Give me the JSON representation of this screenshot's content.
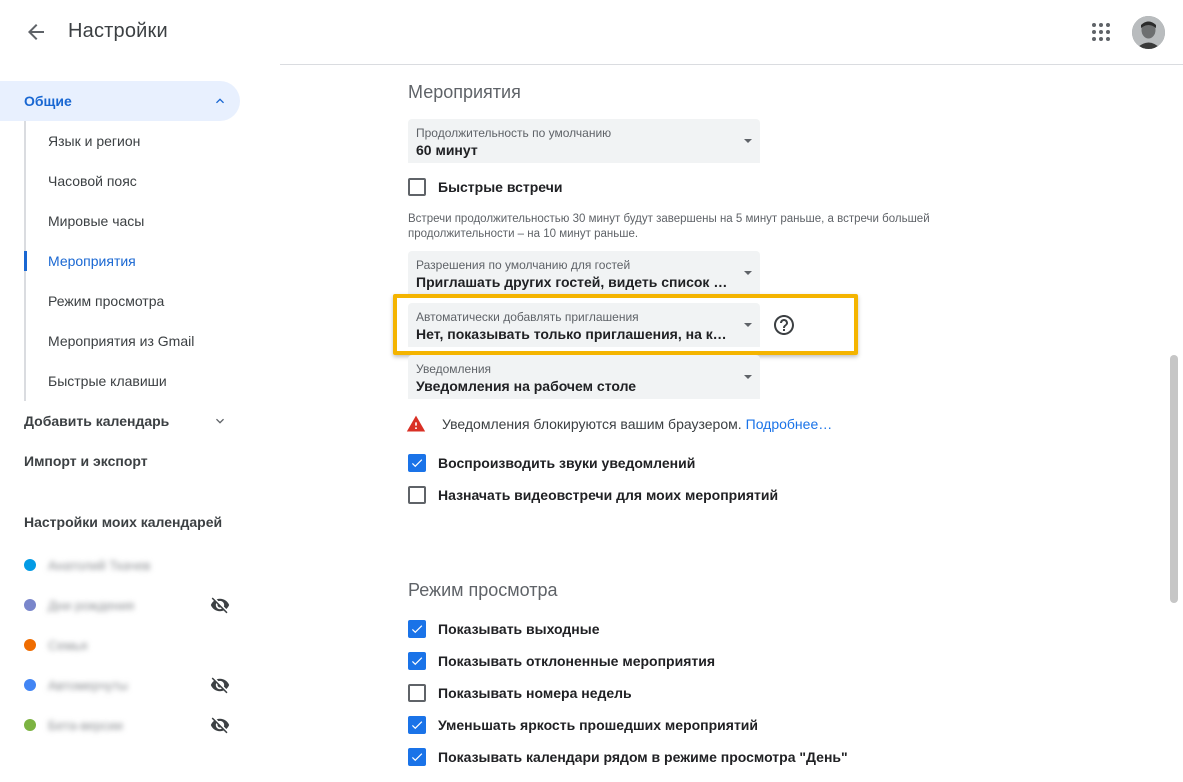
{
  "header": {
    "title": "Настройки",
    "back_icon": "arrow-back-icon",
    "apps_icon": "apps-grid-icon"
  },
  "sidebar": {
    "general": {
      "label": "Общие",
      "expanded": true
    },
    "sub_items": [
      {
        "label": "Язык и регион",
        "active": false
      },
      {
        "label": "Часовой пояс",
        "active": false
      },
      {
        "label": "Мировые часы",
        "active": false
      },
      {
        "label": "Мероприятия",
        "active": true
      },
      {
        "label": "Режим просмотра",
        "active": false
      },
      {
        "label": "Мероприятия из Gmail",
        "active": false
      },
      {
        "label": "Быстрые клавиши",
        "active": false
      }
    ],
    "add_calendar": "Добавить календарь",
    "import_export": "Импорт и экспорт",
    "my_calendars_heading": "Настройки моих календарей",
    "calendars": [
      {
        "name": "Анатолий Ткачев",
        "color": "#039be5",
        "hidden_icon": false
      },
      {
        "name": "Дни рождения",
        "color": "#7986cb",
        "hidden_icon": true
      },
      {
        "name": "Семья",
        "color": "#ef6c00",
        "hidden_icon": false
      },
      {
        "name": "Автомерчуты",
        "color": "#4285f4",
        "hidden_icon": true
      },
      {
        "name": "Бета-версии",
        "color": "#7cb342",
        "hidden_icon": true
      }
    ]
  },
  "events_section": {
    "title": "Мероприятия",
    "default_duration": {
      "label": "Продолжительность по умолчанию",
      "value": "60 минут"
    },
    "speedy_meetings": {
      "label": "Быстрые встречи",
      "checked": false
    },
    "speedy_hint": "Встречи продолжительностью 30 минут будут завершены на 5 минут раньше, а встречи большей продолжительности – на 10 минут раньше.",
    "guest_permissions": {
      "label": "Разрешения по умолчанию для гостей",
      "value": "Приглашать других гостей, видеть список приглашенных"
    },
    "auto_add_invites": {
      "label": "Автоматически добавлять приглашения",
      "value": "Нет, показывать только приглашения, на которые я ответил"
    },
    "notifications": {
      "label": "Уведомления",
      "value": "Уведомления на рабочем столе"
    },
    "warning_text": "Уведомления блокируются вашим браузером.",
    "warning_link": "Подробнее…",
    "play_sounds": {
      "label": "Воспроизводить звуки уведомлений",
      "checked": true
    },
    "video_calls": {
      "label": "Назначать видеовстречи для моих мероприятий",
      "checked": false
    }
  },
  "view_section": {
    "title": "Режим просмотра",
    "options": [
      {
        "label": "Показывать выходные",
        "checked": true
      },
      {
        "label": "Показывать отклоненные мероприятия",
        "checked": true
      },
      {
        "label": "Показывать номера недель",
        "checked": false
      },
      {
        "label": "Уменьшать яркость прошедших мероприятий",
        "checked": true
      },
      {
        "label": "Показывать календари рядом в режиме просмотра \"День\"",
        "checked": true
      }
    ]
  },
  "colors": {
    "accent": "#1a73e8",
    "active_nav_bg": "#e8f0fe",
    "highlight": "#f4b400",
    "warning": "#d93025"
  }
}
